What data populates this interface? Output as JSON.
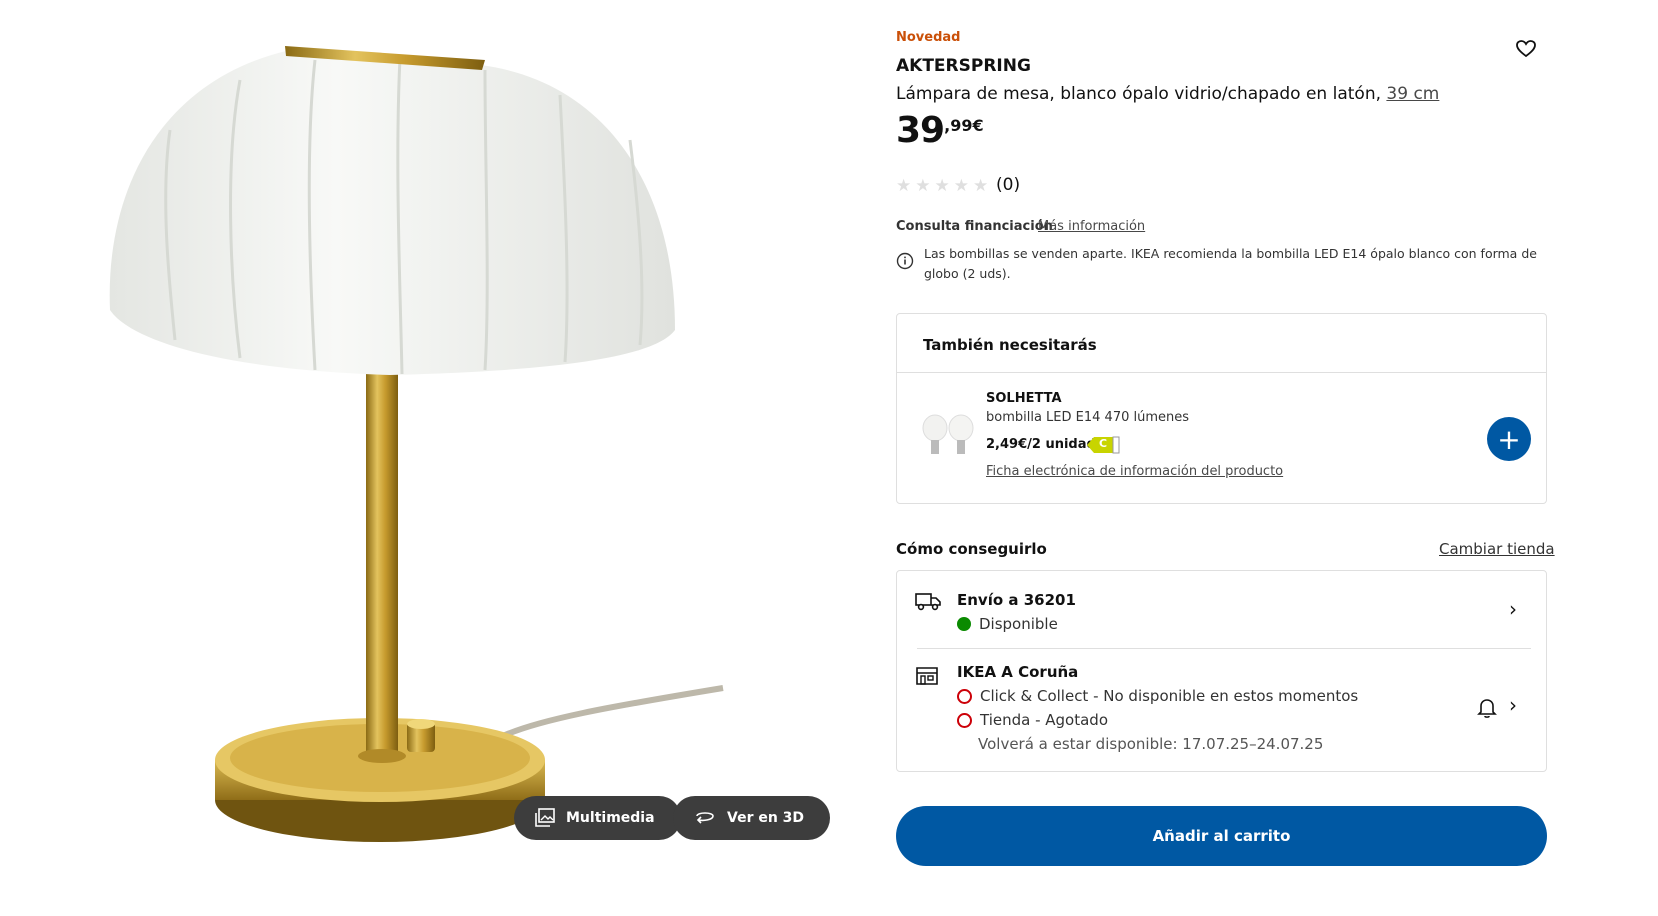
{
  "gallery": {
    "multimedia_label": "Multimedia",
    "view3d_label": "Ver en 3D"
  },
  "product": {
    "badge": "Novedad",
    "name": "AKTERSPRING",
    "description": "Lámpara de mesa, blanco ópalo vidrio/chapado en latón,",
    "size_link": "39 cm",
    "price_int": "39",
    "price_dec": ",99€",
    "rating_count": "(0)",
    "rating_value": 0,
    "rating_max": 5
  },
  "financing": {
    "label": "Consulta financiación",
    "link": "Más información"
  },
  "bulb_note": "Las bombillas se venden aparte. IKEA recomienda la bombilla LED E14 ópalo blanco con forma de globo (2 uds).",
  "also_need": {
    "title": "También necesitarás",
    "item": {
      "name": "SOLHETTA",
      "description": "bombilla LED E14 470 lúmenes",
      "price": "2,49€/2 unidad",
      "energy_class": "C",
      "link": "Ficha electrónica de información del producto"
    }
  },
  "fulfillment": {
    "title": "Cómo conseguirlo",
    "change_store": "Cambiar tienda",
    "delivery": {
      "title": "Envío a 36201",
      "status": "Disponible"
    },
    "store": {
      "title": "IKEA A Coruña",
      "click_collect": "Click & Collect - No disponible en estos momentos",
      "store_status": "Tienda - Agotado",
      "restock": "Volverá a estar disponible: 17.07.25–24.07.25"
    }
  },
  "cart": {
    "label": "Añadir al carrito"
  },
  "colors": {
    "accent": "#0058a3",
    "badge": "#ca5008",
    "available": "#0a8a00",
    "unavailable": "#cc0008"
  }
}
